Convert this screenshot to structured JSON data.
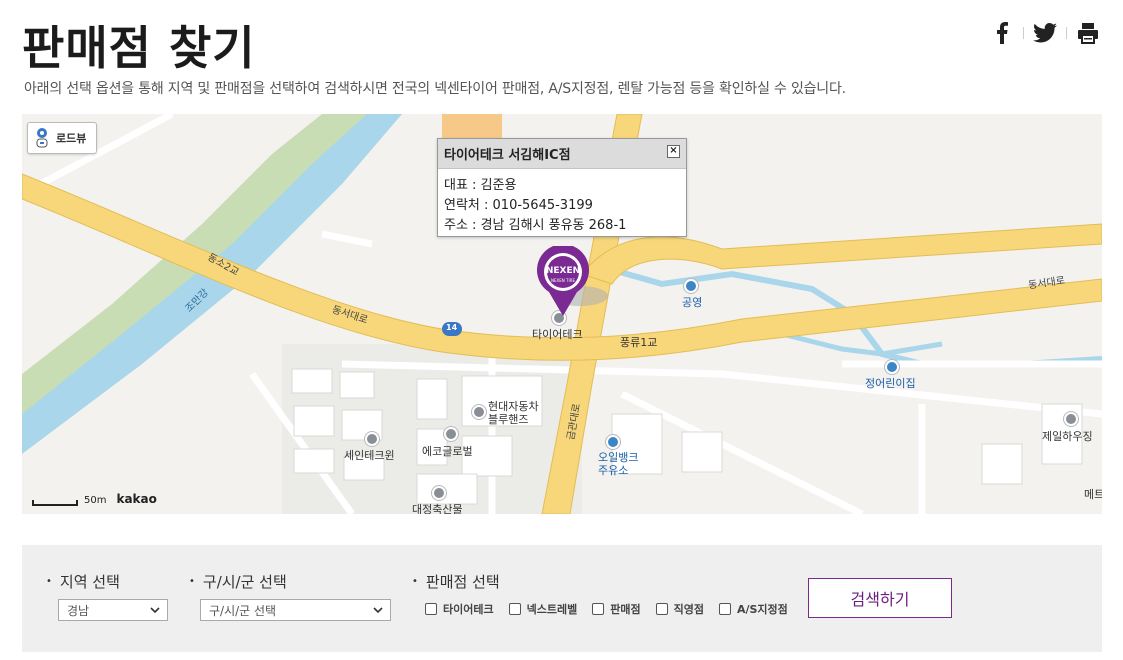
{
  "header": {
    "title": "판매점 찾기",
    "subtitle": "아래의 선택 옵션을 통해 지역 및 판매점을 선택하여 검색하시면 전국의 넥센타이어 판매점, A/S지정점, 렌탈 가능점 등을 확인하실 수 있습니다."
  },
  "social": {
    "icons": [
      "facebook-icon",
      "twitter-icon",
      "print-icon"
    ]
  },
  "map": {
    "roadview_label": "로드뷰",
    "scale_label": "50m",
    "provider": "kakao",
    "labels": {
      "dongso2gyo": "동소2교",
      "joman": "조만강",
      "dongseodaero_left": "동서대로",
      "dongseodaero_right": "동서대로",
      "route": "14",
      "pungryu1gyo": "풍류1교",
      "gyeongjeon": "금관대로",
      "tiretech": "타이어테크",
      "parking": "공영",
      "daycare": "정어린이집",
      "hyundai": "현대자동차\n블루핸즈",
      "seintech": "세인테크윈",
      "ecoglobal": "에코글로벌",
      "oilbank": "오일뱅크\n주유소",
      "jeil": "제일하우징",
      "daejeong": "대정축산물",
      "right_edge": "메트"
    },
    "infowindow": {
      "title": "타이어테크 서김해IC점",
      "close": "×",
      "rep": "대표 : 김준용",
      "phone": "연락처 : 010-5645-3199",
      "address": "주소 : 경남 김해시 풍유동 268-1"
    },
    "marker_brand": "NEXEN",
    "marker_sub": "NEXEN TIRE"
  },
  "search": {
    "region_label": "지역 선택",
    "region_value": "경남",
    "district_label": "구/시/군 선택",
    "district_value": "구/시/군 선택",
    "shop_label": "판매점 선택",
    "shop_options": [
      "타이어테크",
      "넥스트레벨",
      "판매점",
      "직영점",
      "A/S지정점"
    ],
    "button": "검색하기"
  },
  "colors": {
    "accent": "#6a1f7c",
    "road": "#f7d77a",
    "river": "#a9d7ea",
    "park": "#c6dcb2"
  }
}
